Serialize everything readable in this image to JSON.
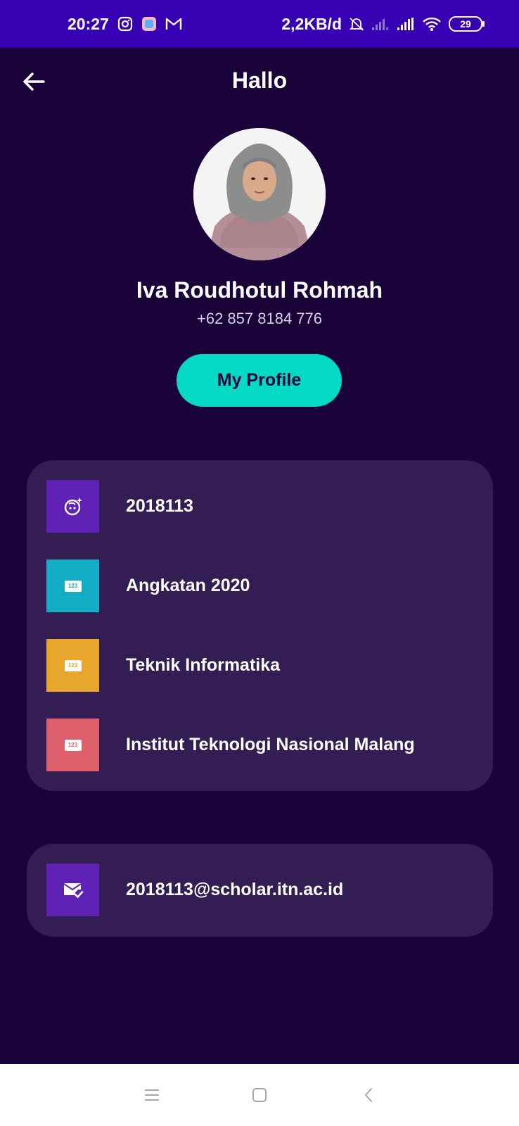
{
  "status_bar": {
    "time": "20:27",
    "network_speed": "2,2KB/d",
    "battery": "29",
    "icons": [
      "instagram-icon",
      "app-icon",
      "gmail-icon",
      "bell-off-icon",
      "signal-weak-icon",
      "signal-icon",
      "wifi-icon"
    ]
  },
  "header": {
    "title": "Hallo",
    "back_icon": "arrow-left-icon"
  },
  "user": {
    "name": "Iva Roudhotul Rohmah",
    "phone": "+62 857 8184 776"
  },
  "profile_button": {
    "label": "My Profile"
  },
  "info_card": {
    "items": [
      {
        "label": "2018113",
        "icon": "face-retouching-icon",
        "color": "#5f22b5"
      },
      {
        "label": "Angkatan 2020",
        "icon": "numbers-123-icon",
        "color": "#13aec5"
      },
      {
        "label": "Teknik Informatika",
        "icon": "numbers-123-icon",
        "color": "#e7a62c"
      },
      {
        "label": "Institut Teknologi Nasional Malang",
        "icon": "numbers-123-icon",
        "color": "#dc5f6b"
      }
    ]
  },
  "email_card": {
    "label": "2018113@scholar.itn.ac.id",
    "icon": "mark-email-read-icon",
    "color": "#5f22b5"
  },
  "badge_text": "123",
  "nav": {
    "icons": [
      "menu-icon",
      "home-square-icon",
      "back-chevron-icon"
    ]
  },
  "colors": {
    "background": "#1a0338",
    "status_bar": "#3700b3",
    "card": "#331d52",
    "accent": "#03dac5"
  }
}
